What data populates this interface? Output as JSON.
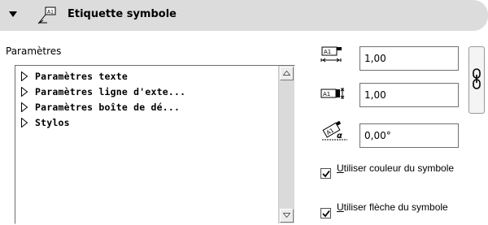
{
  "header": {
    "title": "Etiquette symbole",
    "icon": "label-symbol-icon"
  },
  "section_label": "Paramètres",
  "tree_items": [
    {
      "label": "Paramètres texte"
    },
    {
      "label": "Paramètres ligne d'exte..."
    },
    {
      "label": "Paramètres boîte de dé..."
    },
    {
      "label": "Stylos"
    }
  ],
  "fields": {
    "width": {
      "value": "1,00",
      "icon": "width-icon"
    },
    "height": {
      "value": "1,00",
      "icon": "height-icon"
    },
    "angle": {
      "value": "0,00°",
      "icon": "angle-icon"
    }
  },
  "link_icon": "chain-link-icon",
  "checkboxes": [
    {
      "first_letter": "U",
      "rest": "tiliser couleur du symbole",
      "checked": true
    },
    {
      "first_letter": "U",
      "rest": "tiliser flèche du symbole",
      "checked": true
    }
  ]
}
